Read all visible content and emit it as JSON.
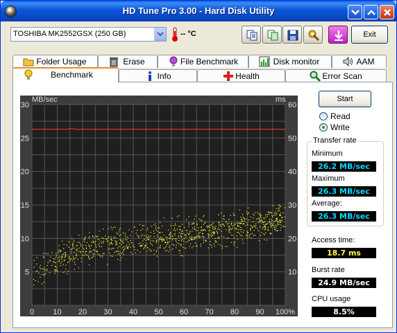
{
  "window": {
    "title": "HD Tune Pro 3.00 - Hard Disk Utility"
  },
  "toolbar": {
    "drive": "TOSHIBA MK2552GSX (250 GB)",
    "temperature": "-- °C",
    "exit_label": "Exit"
  },
  "tabs": {
    "row1": [
      {
        "label": "Folder Usage",
        "icon": "folder-icon"
      },
      {
        "label": "Erase",
        "icon": "trash-icon"
      },
      {
        "label": "File Benchmark",
        "icon": "bulb-icon"
      },
      {
        "label": "Disk monitor",
        "icon": "monitor-chart-icon"
      },
      {
        "label": "AAM",
        "icon": "speaker-icon"
      }
    ],
    "row2": [
      {
        "label": "Benchmark",
        "icon": "bulb-icon",
        "active": true
      },
      {
        "label": "Info",
        "icon": "info-icon"
      },
      {
        "label": "Health",
        "icon": "red-cross-icon"
      },
      {
        "label": "Error Scan",
        "icon": "magnifier-icon"
      }
    ]
  },
  "controls": {
    "start_label": "Start",
    "read_label": "Read",
    "write_label": "Write",
    "mode": "Write"
  },
  "stats": {
    "transfer_rate_title": "Transfer rate",
    "minimum_label": "Minimum",
    "minimum_value": "26.2 MB/sec",
    "maximum_label": "Maximum",
    "maximum_value": "26.3 MB/sec",
    "average_label": "Average:",
    "average_value": "26.3 MB/sec",
    "access_label": "Access time:",
    "access_value": "18.7 ms",
    "burst_label": "Burst rate",
    "burst_value": "24.9 MB/sec",
    "cpu_label": "CPU usage",
    "cpu_value": "8.5%"
  },
  "chart_data": {
    "type": "scatter",
    "ylabel_left": "MB/sec",
    "ylabel_right": "ms",
    "x_ticks": [
      "0",
      "10",
      "20",
      "30",
      "40",
      "50",
      "60",
      "70",
      "80",
      "90",
      "100%"
    ],
    "y_left_ticks": [
      "30",
      "25",
      "20",
      "15",
      "10",
      "5"
    ],
    "y_right_ticks": [
      "60",
      "50",
      "40",
      "30",
      "20",
      "10"
    ],
    "xlim": [
      0,
      100
    ],
    "ylim_left": [
      0,
      30
    ],
    "ylim_right": [
      0,
      60
    ],
    "grid": true,
    "series": [
      {
        "axis": "left",
        "type": "line",
        "color": "#ff3b3b",
        "x": [
          0,
          14,
          15,
          16,
          17,
          18,
          100
        ],
        "y": [
          26.3,
          26.3,
          26.4,
          26.4,
          26.3,
          26.3,
          26.3
        ]
      },
      {
        "axis": "right",
        "type": "scatter",
        "color": "#ffff30",
        "density": 1000,
        "trend": {
          "x": [
            0,
            20,
            50,
            80,
            100
          ],
          "y_ms": [
            10,
            17,
            20,
            23,
            26
          ]
        },
        "spread_ms": 7
      }
    ]
  }
}
